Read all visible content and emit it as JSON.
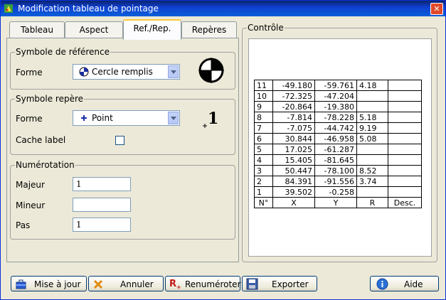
{
  "window": {
    "title": "Modification tableau de pointage",
    "close_label": "✕"
  },
  "tabs": [
    {
      "label": "Tableau"
    },
    {
      "label": "Aspect"
    },
    {
      "label": "Ref./Rep."
    },
    {
      "label": "Repères"
    }
  ],
  "ref_symbol": {
    "group_label": "Symbole de référence",
    "forme_label": "Forme",
    "forme_value": "Cercle remplis"
  },
  "rep_symbol": {
    "group_label": "Symbole repère",
    "forme_label": "Forme",
    "forme_value": "Point",
    "cache_label": "Cache label",
    "preview_text": "1"
  },
  "numerotation": {
    "group_label": "Numérotation",
    "majeur_label": "Majeur",
    "majeur_value": "1",
    "mineur_label": "Mineur",
    "mineur_value": "",
    "pas_label": "Pas",
    "pas_value": "1"
  },
  "controle": {
    "group_label": "Contrôle",
    "rows": [
      {
        "n": "11",
        "x": "-49.180",
        "y": "-59.761",
        "r": "4.18",
        "d": ""
      },
      {
        "n": "10",
        "x": "-72.325",
        "y": "-47.204",
        "r": "",
        "d": ""
      },
      {
        "n": "9",
        "x": "-20.864",
        "y": "-19.380",
        "r": "",
        "d": ""
      },
      {
        "n": "8",
        "x": "-7.814",
        "y": "-78.228",
        "r": "5.18",
        "d": ""
      },
      {
        "n": "7",
        "x": "-7.075",
        "y": "-44.742",
        "r": "9.19",
        "d": ""
      },
      {
        "n": "6",
        "x": "30.844",
        "y": "-46.958",
        "r": "5.08",
        "d": ""
      },
      {
        "n": "5",
        "x": "17.025",
        "y": "-61.287",
        "r": "",
        "d": ""
      },
      {
        "n": "4",
        "x": "15.405",
        "y": "-81.645",
        "r": "",
        "d": ""
      },
      {
        "n": "3",
        "x": "50.447",
        "y": "-78.100",
        "r": "8.52",
        "d": ""
      },
      {
        "n": "2",
        "x": "84.391",
        "y": "-91.556",
        "r": "3.74",
        "d": ""
      },
      {
        "n": "1",
        "x": "39.502",
        "y": "-0.258",
        "r": "",
        "d": ""
      }
    ],
    "headers": {
      "n": "N°",
      "x": "X",
      "y": "Y",
      "r": "R",
      "d": "Desc."
    }
  },
  "buttons": {
    "update": "Mise à jour",
    "cancel": "Annuler",
    "renumber": "Renuméroter",
    "export": "Exporter",
    "help": "Aide"
  }
}
